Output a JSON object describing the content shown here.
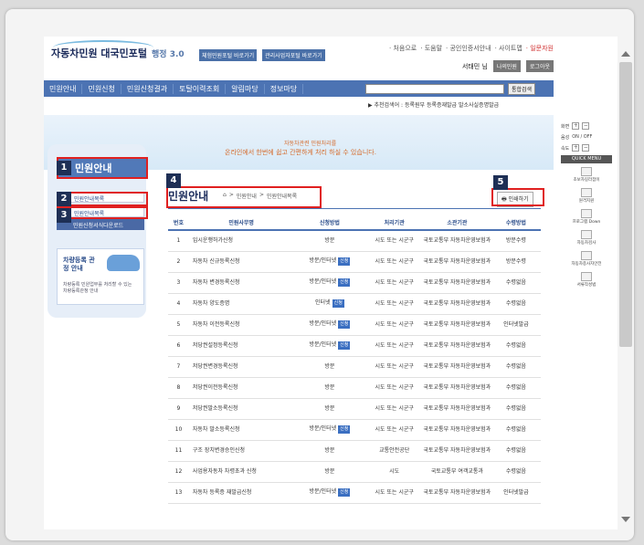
{
  "header": {
    "logo": "자동차민원 대국민포털",
    "logo_sub": "행정 3.0",
    "btn_a": "체험민원포털 바로가기",
    "btn_b": "관리사업자포털 바로가기",
    "topnav": [
      "· 처음으로",
      "· 도움말",
      "· 공인인증서안내",
      "· 사이트맵"
    ],
    "topnav_red": "· 일문자원",
    "user_name": "서태민 님",
    "my_btn": "나의민원",
    "logout_btn": "로그아웃"
  },
  "menu": [
    "민원안내",
    "민원신청",
    "민원신청결과",
    "토탈이력조회",
    "알림마당",
    "정보마당"
  ],
  "search": {
    "placeholder": "",
    "button": "통합검색"
  },
  "subbar": "▶ 추천검색어 : 등록원부  등록증재발급  말소사실증명발급",
  "banner": {
    "line1": "자동차관련 민원처리를",
    "line2": "온라인에서 한번에 쉽고 간편하게 처리 하실 수 있습니다."
  },
  "sidebar": {
    "title": "민원안내",
    "item1": "민원안내목록",
    "item2": "민원안내목록",
    "item3": "민원신청서식다운로드",
    "ad_title": "차량등록 관정 안내",
    "ad_desc": "차량등록 민원업무를 처리할 수 있는 차량등록관청 안내"
  },
  "main": {
    "title": "민원안내",
    "breadcrumb": [
      "⌂",
      ">",
      "민원안내",
      ">",
      "민원안내목록"
    ],
    "print": "인쇄하기"
  },
  "table": {
    "headers": [
      "번호",
      "민원사무명",
      "신청방법",
      "처리기관",
      "소관기관",
      "수령방법"
    ],
    "rows": [
      [
        "1",
        "임시운행허가신청",
        "방문",
        "",
        "시도 또는 시군구",
        "국토교통부 자동차운영보험과",
        "방문수령"
      ],
      [
        "2",
        "자동차 신규등록신청",
        "방문/인터넷",
        "신청",
        "시도 또는 시군구",
        "국토교통부 자동차운영보험과",
        "방문수령"
      ],
      [
        "3",
        "자동차 변경등록신청",
        "방문/인터넷",
        "신청",
        "시도 또는 시군구",
        "국토교통부 자동차운영보험과",
        "수령없음"
      ],
      [
        "4",
        "자동차 양도증명",
        "인터넷",
        "신청",
        "시도 또는 시군구",
        "국토교통부 자동차운영보험과",
        "수령없음"
      ],
      [
        "5",
        "자동차 이전등록신청",
        "방문/인터넷",
        "신청",
        "시도 또는 시군구",
        "국토교통부 자동차운영보험과",
        "인터넷발급"
      ],
      [
        "6",
        "저당권설정등록신청",
        "방문/인터넷",
        "신청",
        "시도 또는 시군구",
        "국토교통부 자동차운영보험과",
        "수령없음"
      ],
      [
        "7",
        "저당권변경등록신청",
        "방문",
        "",
        "시도 또는 시군구",
        "국토교통부 자동차운영보험과",
        "수령없음"
      ],
      [
        "8",
        "저당권이전등록신청",
        "방문",
        "",
        "시도 또는 시군구",
        "국토교통부 자동차운영보험과",
        "수령없음"
      ],
      [
        "9",
        "저당권말소등록신청",
        "방문",
        "",
        "시도 또는 시군구",
        "국토교통부 자동차운영보험과",
        "수령없음"
      ],
      [
        "10",
        "자동차 말소등록신청",
        "방문/인터넷",
        "신청",
        "시도 또는 시군구",
        "국토교통부 자동차운영보험과",
        "수령없음"
      ],
      [
        "11",
        "구조 장치변경승인신청",
        "방문",
        "",
        "교통안전공단",
        "국토교통부 자동차운영보험과",
        "수령없음"
      ],
      [
        "12",
        "사업용자동차 차령초과 신청",
        "방문",
        "",
        "시도",
        "국토교통부 여객교통과",
        "수령없음"
      ],
      [
        "13",
        "자동차 등록증 재발급신청",
        "방문/인터넷",
        "신청",
        "시도 또는 시군구",
        "국토교통부 자동차운영보험과",
        "인터넷발급"
      ]
    ]
  },
  "quick": {
    "r1": "화면",
    "r2": "음성",
    "r2_val": "ON / OFF",
    "r3": "속도",
    "head": "QUICK MENU",
    "icons": [
      "초보자길라잡이",
      "원격지원",
      "프로그램 Down",
      "자동차검사",
      "자동차종사자안전",
      "서류작성법"
    ]
  },
  "annotations": [
    "1",
    "2",
    "3",
    "4",
    "5"
  ]
}
